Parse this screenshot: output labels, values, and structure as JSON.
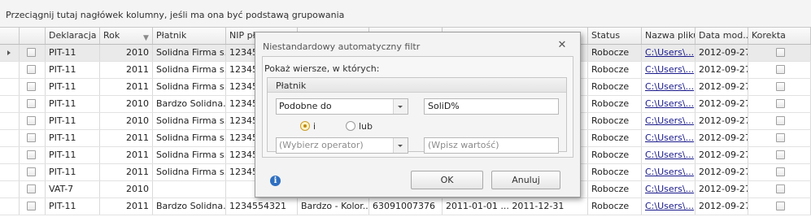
{
  "group_panel": {
    "hint": "Przeciągnij tutaj nagłówek kolumny, jeśli ma ona być podstawą grupowania"
  },
  "columns": [
    "Deklaracja",
    "Rok",
    "Płatnik",
    "NIP pł",
    "",
    "",
    "",
    "Status",
    "Nazwa pliku",
    "Data mod...",
    "Korekta"
  ],
  "rows": [
    [
      "PIT-11",
      "2010",
      "Solidna Firma s...",
      "12345",
      "",
      "",
      "",
      "Robocze",
      "C:\\Users\\...",
      "2012-09-27"
    ],
    [
      "PIT-11",
      "2011",
      "Solidna Firma s...",
      "12345",
      "",
      "",
      "",
      "Robocze",
      "C:\\Users\\...",
      "2012-09-27"
    ],
    [
      "PIT-11",
      "2011",
      "Solidna Firma s...",
      "12345",
      "",
      "",
      "",
      "Robocze",
      "C:\\Users\\...",
      "2012-09-27"
    ],
    [
      "PIT-11",
      "2010",
      "Bardzo Solidna...",
      "12345",
      "",
      "",
      "",
      "Robocze",
      "C:\\Users\\...",
      "2012-09-27"
    ],
    [
      "PIT-11",
      "2010",
      "Solidna Firma s...",
      "12345",
      "",
      "",
      "",
      "Robocze",
      "C:\\Users\\...",
      "2012-09-27"
    ],
    [
      "PIT-11",
      "2011",
      "Solidna Firma s...",
      "12345",
      "",
      "",
      "",
      "Robocze",
      "C:\\Users\\...",
      "2012-09-27"
    ],
    [
      "PIT-11",
      "2011",
      "Solidna Firma s...",
      "12345",
      "",
      "",
      "",
      "Robocze",
      "C:\\Users\\...",
      "2012-09-27"
    ],
    [
      "PIT-11",
      "2011",
      "Solidna Firma s...",
      "12345",
      "",
      "",
      "",
      "Robocze",
      "C:\\Users\\...",
      "2012-09-27"
    ],
    [
      "VAT-7",
      "2010",
      "",
      "",
      "",
      "",
      "",
      "Robocze",
      "C:\\Users\\...",
      "2012-09-27"
    ],
    [
      "PIT-11",
      "2011",
      "Bardzo Solidna...",
      "1234554321",
      "Bardzo - Kolor...",
      "63091007376",
      "2011-01-01 ... 2011-12-31",
      "Robocze",
      "C:\\Users\\...",
      "2012-09-27"
    ]
  ],
  "dialog": {
    "title": "Niestandardowy automatyczny filtr",
    "show_rows_label": "Pokaż wiersze, w których:",
    "group_title": "Płatnik",
    "operator1": "Podobne do",
    "value1": "SoliD%",
    "radio_and": "i",
    "radio_or": "lub",
    "operator2_placeholder": "(Wybierz operator)",
    "value2_placeholder": "(Wpisz wartość)",
    "ok_label": "OK",
    "cancel_label": "Anuluj"
  }
}
